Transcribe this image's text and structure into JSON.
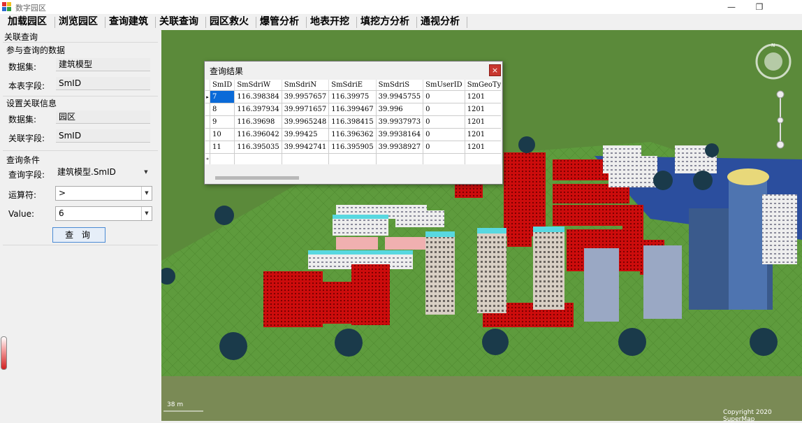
{
  "window": {
    "title": "数字园区",
    "restore_glyph": "❐",
    "minimize_glyph": "—"
  },
  "menu": [
    "加载园区",
    "浏览园区",
    "查询建筑",
    "关联查询",
    "园区救火",
    "爆管分析",
    "地表开挖",
    "填挖方分析",
    "通视分析"
  ],
  "panel": {
    "title": "关联查询",
    "group1": {
      "title": "参与查询的数据",
      "dataset_label": "数据集:",
      "dataset_value": "建筑模型",
      "field_label": "本表字段:",
      "field_value": "SmID"
    },
    "group2": {
      "title": "设置关联信息",
      "dataset_label": "数据集:",
      "dataset_value": "园区",
      "field_label": "关联字段:",
      "field_value": "SmID"
    },
    "group3": {
      "title": "查询条件",
      "field_label": "查询字段:",
      "field_value": "建筑模型.SmID",
      "op_label": "运算符:",
      "op_value": ">",
      "value_label": "Value:",
      "value_value": "6"
    },
    "query_button": "查 询"
  },
  "result_dialog": {
    "title": "查询结果",
    "close": "×",
    "columns": [
      "SmID",
      "SmSdriW",
      "SmSdriN",
      "SmSdriE",
      "SmSdriS",
      "SmUserID",
      "SmGeoTy"
    ],
    "rows": [
      [
        "7",
        "116.398384",
        "39.9957657",
        "116.39975",
        "39.9945755",
        "0",
        "1201"
      ],
      [
        "8",
        "116.397934",
        "39.9971657",
        "116.399467",
        "39.996",
        "0",
        "1201"
      ],
      [
        "9",
        "116.39698",
        "39.9965248",
        "116.398415",
        "39.9937973",
        "0",
        "1201"
      ],
      [
        "10",
        "116.396042",
        "39.99425",
        "116.396362",
        "39.9938164",
        "0",
        "1201"
      ],
      [
        "11",
        "116.395035",
        "39.9942741",
        "116.395905",
        "39.9938927",
        "0",
        "1201"
      ]
    ],
    "current_row_marker": "▸",
    "new_row_marker": "*"
  },
  "map": {
    "scale": "38 m",
    "copyright": "Copyright 2020 SuperMap",
    "compass_n": "N"
  },
  "colors": {
    "grass": "#5b9a3b",
    "selected_building": "#d10f0f",
    "selection": "#0a6ad8",
    "close_button": "#c8372f"
  }
}
